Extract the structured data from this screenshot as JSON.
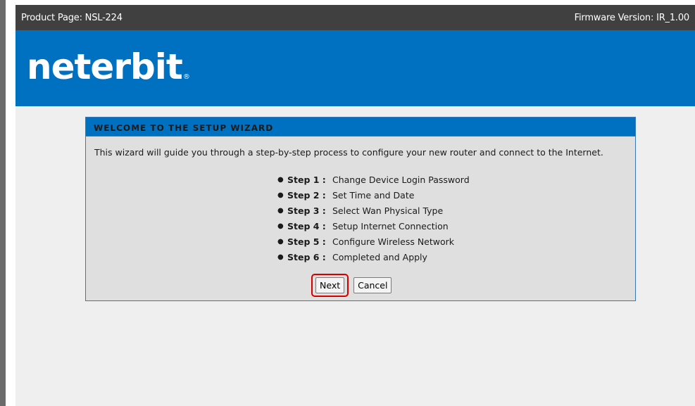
{
  "header": {
    "product": "Product Page: NSL-224",
    "firmware": "Firmware Version: IR_1.00"
  },
  "brand": {
    "logo_text": "neterbit",
    "logo_mark": "®"
  },
  "wizard": {
    "title": "WELCOME TO THE SETUP WIZARD",
    "intro": "This wizard will guide you through a step-by-step process to configure your new router and connect to the Internet.",
    "steps": [
      {
        "label": "Step 1 :",
        "text": "Change Device Login Password"
      },
      {
        "label": "Step 2 :",
        "text": "Set Time and Date"
      },
      {
        "label": "Step 3 :",
        "text": "Select Wan Physical Type"
      },
      {
        "label": "Step 4 :",
        "text": "Setup Internet Connection"
      },
      {
        "label": "Step 5 :",
        "text": "Configure Wireless Network"
      },
      {
        "label": "Step 6 :",
        "text": "Completed and Apply"
      }
    ],
    "buttons": {
      "next": "Next",
      "cancel": "Cancel"
    }
  },
  "colors": {
    "banner": "#0070c0",
    "topbar": "#404040",
    "highlight": "#d40000"
  }
}
